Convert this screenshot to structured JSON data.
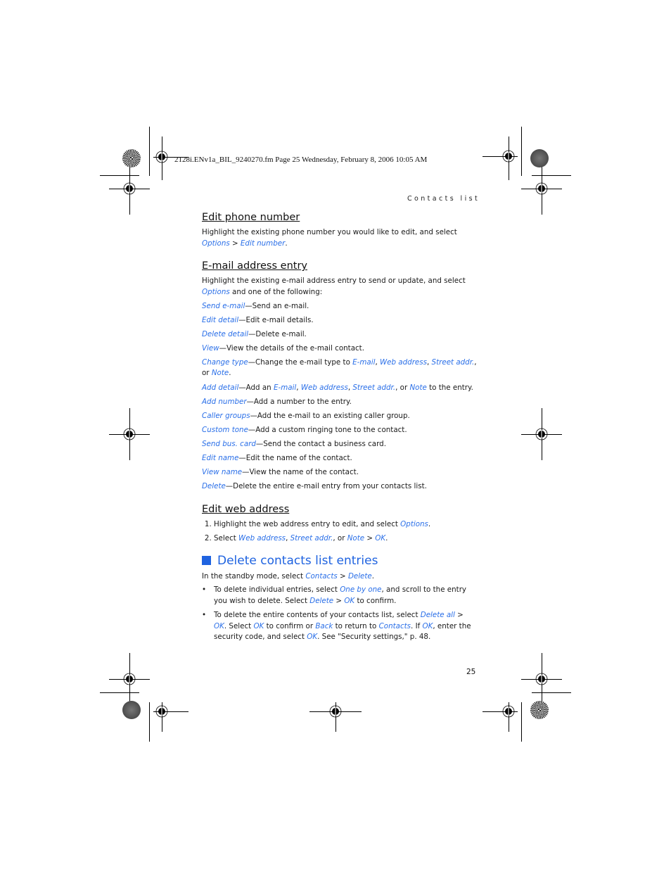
{
  "slug": "2128i.ENv1a_BIL_9240270.fm  Page 25  Wednesday, February 8, 2006  10:05 AM",
  "running_head": "Contacts list",
  "page_number": "25",
  "sections": {
    "edit_phone": {
      "heading": "Edit phone number",
      "text1": "Highlight the existing phone number you would like to edit, and select ",
      "link1": "Options",
      "sep1": " > ",
      "link2": "Edit number",
      "end": "."
    },
    "email_entry": {
      "heading": "E-mail address entry",
      "intro1": "Highlight the existing e-mail address entry to send or update, and select ",
      "intro_link": "Options",
      "intro2": " and one of the following:",
      "items": [
        {
          "term": "Send e-mail",
          "desc": "—Send an e-mail."
        },
        {
          "term": "Edit detail",
          "desc": "—Edit e-mail details."
        },
        {
          "term": "Delete detail",
          "desc": "—Delete e-mail."
        },
        {
          "term": "View",
          "desc": "—View the details of the e-mail contact."
        },
        {
          "term": "Change type",
          "desc": "—Change the e-mail type to ",
          "l1": "E-mail",
          "s1": ", ",
          "l2": "Web address",
          "s2": ", ",
          "l3": "Street addr.",
          "s3": ", or ",
          "l4": "Note",
          "s4": "."
        },
        {
          "term": "Add detail",
          "desc": "—Add an ",
          "l1": "E-mail",
          "s1": ", ",
          "l2": "Web address",
          "s2": ", ",
          "l3": "Street addr.",
          "s3": ", or ",
          "l4": "Note",
          "s4": " to the entry."
        },
        {
          "term": "Add number",
          "desc": "—Add a number to the entry."
        },
        {
          "term": "Caller groups",
          "desc": "—Add the e-mail to an existing caller group."
        },
        {
          "term": "Custom tone",
          "desc": "—Add a custom ringing tone to the contact."
        },
        {
          "term": "Send bus. card",
          "desc": "—Send the contact a business card."
        },
        {
          "term": "Edit name",
          "desc": "—Edit the name of the contact."
        },
        {
          "term": "View name",
          "desc": "—View the name of the contact."
        },
        {
          "term": "Delete",
          "desc": "—Delete the entire e-mail entry from your contacts list."
        }
      ]
    },
    "edit_web": {
      "heading": "Edit web address",
      "step1_text": "Highlight the web address entry to edit, and select ",
      "step1_link": "Options",
      "step1_end": ".",
      "step2_text": "Select ",
      "step2_l1": "Web address",
      "step2_s1": ", ",
      "step2_l2": "Street addr.",
      "step2_s2": ", or ",
      "step2_l3": "Note",
      "step2_s3": " > ",
      "step2_l4": "OK",
      "step2_end": "."
    },
    "delete_entries": {
      "heading": "Delete contacts list entries",
      "intro1": "In the standby mode, select ",
      "intro_l1": "Contacts",
      "intro_s1": " > ",
      "intro_l2": "Delete",
      "intro_end": ".",
      "bullet": "•",
      "b1_t1": "To delete individual entries, select ",
      "b1_l1": "One by one",
      "b1_t2": ", and scroll to the entry you wish to delete. Select ",
      "b1_l2": "Delete",
      "b1_t3": " > ",
      "b1_l3": "OK",
      "b1_t4": " to confirm.",
      "b2_t1": "To delete the entire contents of your contacts list, select ",
      "b2_l1": "Delete all",
      "b2_t2": " > ",
      "b2_l2": "OK",
      "b2_t3": ". Select ",
      "b2_l3": "OK",
      "b2_t4": " to confirm or ",
      "b2_l4": "Back",
      "b2_t5": " to return to ",
      "b2_l5": "Contacts",
      "b2_t6": ". If ",
      "b2_l6": "OK",
      "b2_t7": ", enter the security code, and select ",
      "b2_l7": "OK",
      "b2_t8": ". See \"Security settings,\" p. 48."
    }
  },
  "colors": {
    "accent": "#1f63e0",
    "link": "#2a6fe8",
    "text": "#1a1a1a"
  }
}
